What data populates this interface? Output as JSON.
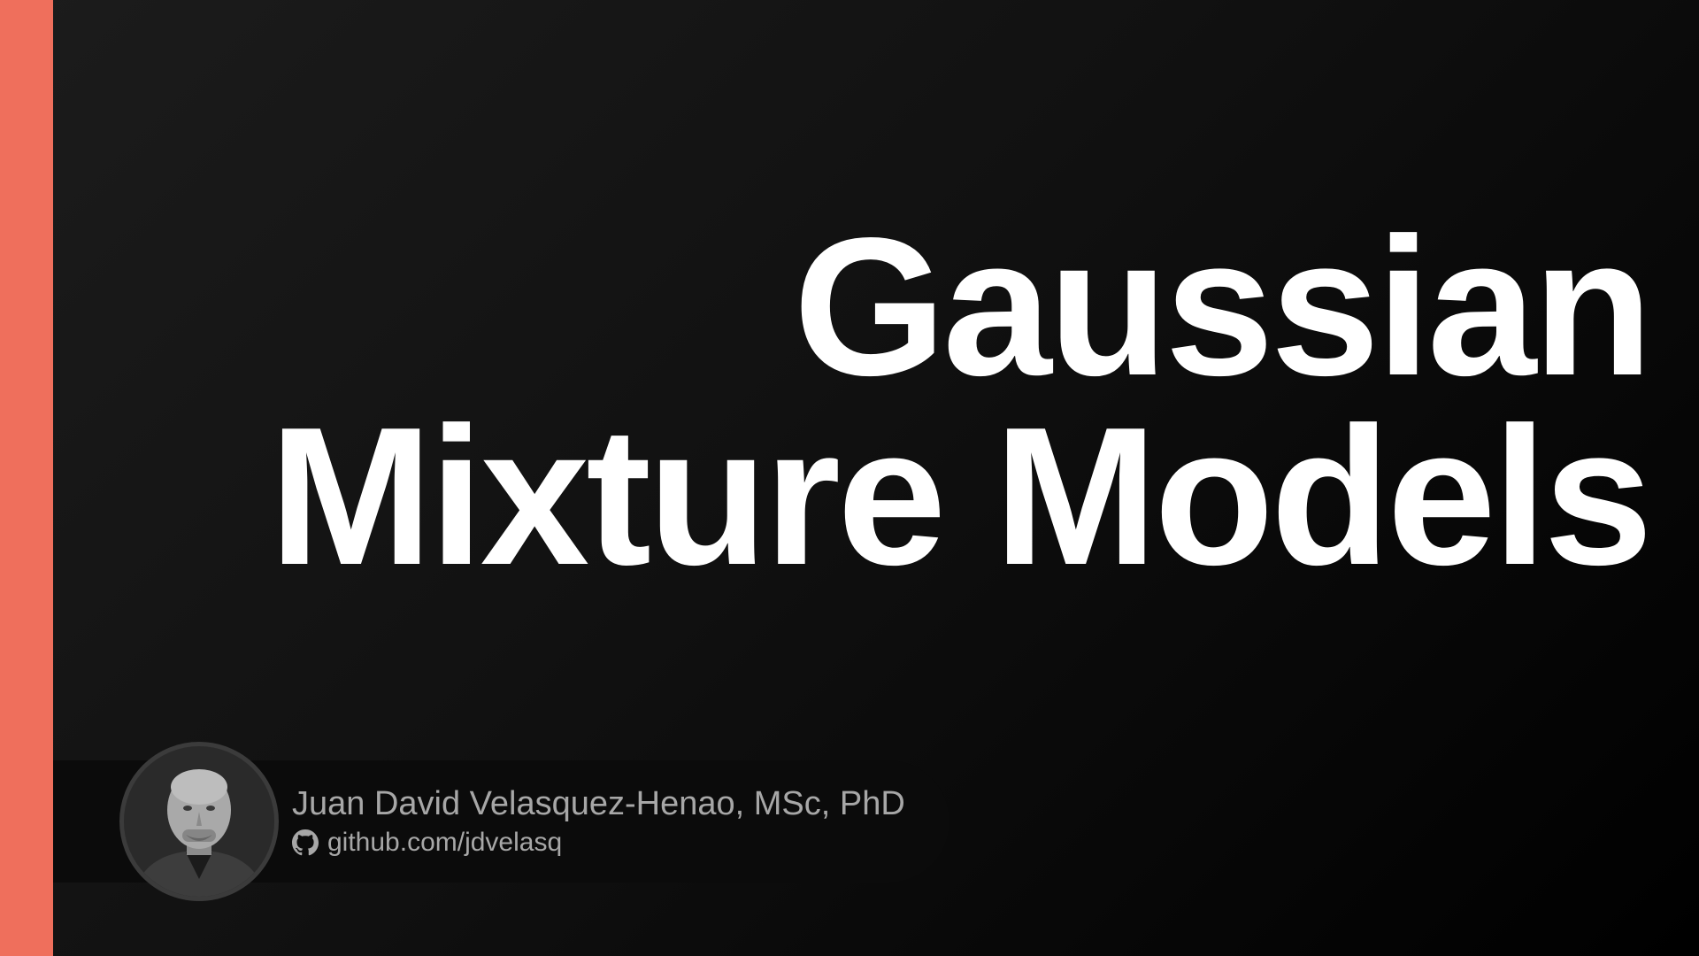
{
  "slide": {
    "title_line_1": "Gaussian",
    "title_line_2": "Mixture Models"
  },
  "author": {
    "name": "Juan David Velasquez-Henao, MSc, PhD",
    "github": "github.com/jdvelasq",
    "github_icon": "github-icon",
    "avatar": "author-photo"
  },
  "colors": {
    "accent": "#ef6f5c",
    "background": "#111111",
    "title": "#ffffff",
    "author_text": "#a7a7a7"
  }
}
